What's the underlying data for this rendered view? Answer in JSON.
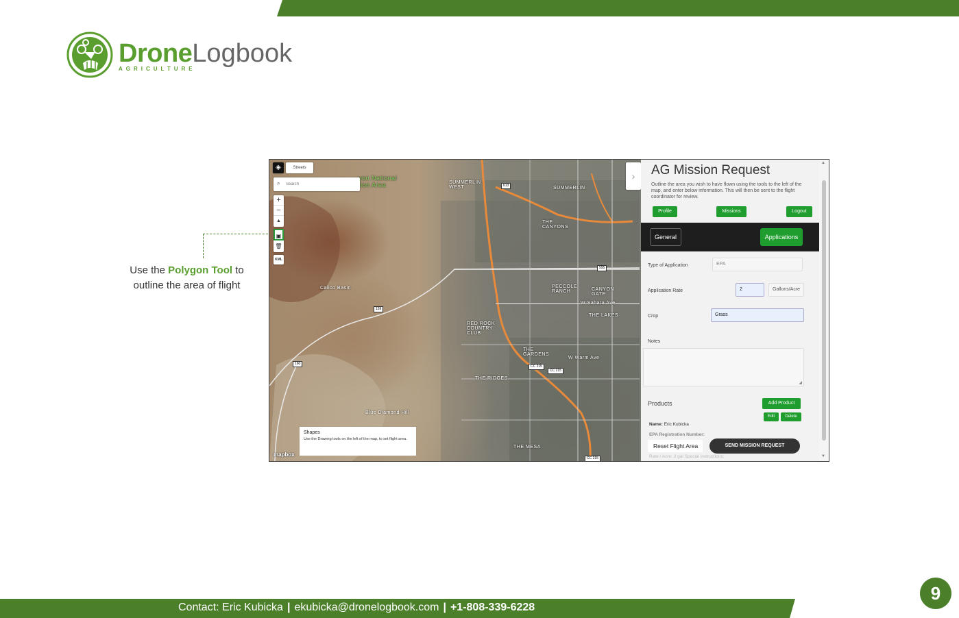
{
  "slide": {
    "logo_bold": "Drone",
    "logo_light": "Logbook",
    "logo_sub": "AGRICULTURE",
    "annotation_pre": "Use the",
    "annotation_hl": "Polygon Tool",
    "annotation_post": "to outline the area of flight",
    "contact_name": "Contact: Eric Kubicka",
    "contact_email": "ekubicka@dronelogbook.com",
    "contact_phone": "+1-808-339-6228",
    "contact_sep": "|",
    "page_number": "9",
    "brand_color": "#4b7f2a"
  },
  "map": {
    "style_label": "Streets",
    "search_placeholder": "Search",
    "zoom_in": "+",
    "zoom_out": "−",
    "compass": "▲",
    "kml_label": "KML",
    "expand_icon": "›",
    "labels": {
      "park": "yon National\ntion Area",
      "summerlin_n": "SUMMERLIN\nWEST",
      "summerlin": "SUMMERLIN",
      "canyons": "THE\nCANYONS",
      "peccole": "PECCOLE\nRANCH",
      "canyon_gate": "CANYON\nGATE",
      "sahara": "W Sahara Ave",
      "lakes": "THE LAKES",
      "redrock": "RED ROCK\nCOUNTRY\nCLUB",
      "gardens": "THE\nGARDENS",
      "ridges": "THE RIDGES",
      "mesa": "THE MESA",
      "calico": "Calico Basin",
      "blue_diamond": "Blue Diamond Hill",
      "warm_springs": "W Warm Ave",
      "rt613": "613",
      "rt159": "159",
      "rt160": "160",
      "cc215a": "CC 215",
      "cc215b": "CC 215",
      "cc215c": "CC 215",
      "rt595": "595"
    },
    "shapes_title": "Shapes",
    "shapes_desc": "Use the Drawing tools on the left of the map, to set flight area.",
    "mapbox": "mapbox"
  },
  "panel": {
    "title": "AG Mission Request",
    "description": "Outline the area you wish to have flown using the tools to the left of the map, and enter below information. This will then be sent to the flight coordinator for review.",
    "btn_profile": "Profile",
    "btn_missions": "Missions",
    "btn_logout": "Logout",
    "tab_general": "General",
    "tab_applications": "Applications",
    "type_label": "Type of Application",
    "type_placeholder": "EPA",
    "rate_label": "Application Rate",
    "rate_value": "2",
    "rate_unit": "Gallons/Acre",
    "crop_label": "Crop",
    "crop_value": "Grass",
    "notes_label": "Notes",
    "products_title": "Products",
    "btn_add_product": "Add Product",
    "btn_edit": "Edit",
    "btn_delete": "Delete",
    "prod_name_label": "Name:",
    "prod_name_value": "Eric Kubicka",
    "prod_epa_label": "EPA Registration Number:",
    "prod_rate_label": "Rate / Acre: 2 gal   Special instructions:",
    "btn_reset": "Reset Flight Area",
    "btn_send": "SEND MISSION REQUEST",
    "accent_color": "#1f9d2e"
  }
}
